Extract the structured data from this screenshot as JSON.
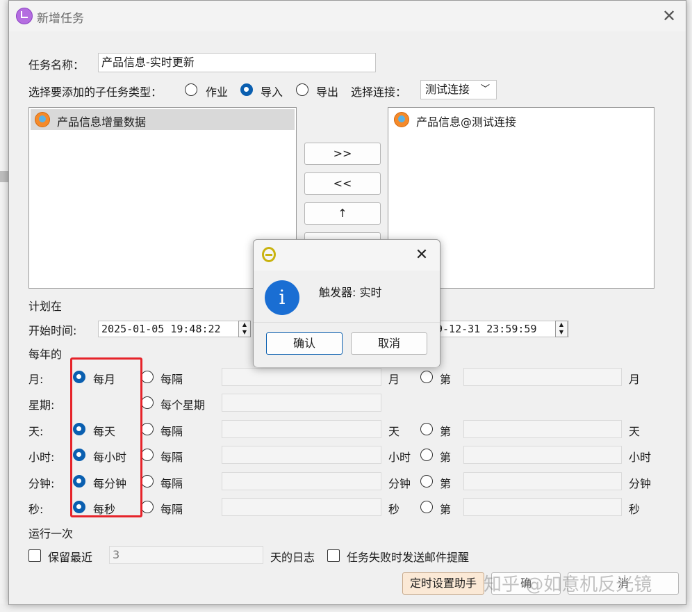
{
  "dialog": {
    "title": "新增任务",
    "close_symbol": "✕"
  },
  "task_name": {
    "label": "任务名称：",
    "value": "产品信息-实时更新"
  },
  "subtask": {
    "label": "选择要添加的子任务类型：",
    "options": [
      "作业",
      "导入",
      "导出"
    ],
    "selected": "导入",
    "connection_label": "选择连接：",
    "connection_value": "测试连接"
  },
  "left_list": {
    "items": [
      "产品信息增量数据"
    ]
  },
  "right_list": {
    "items": [
      "产品信息@测试连接"
    ]
  },
  "transfer_buttons": [
    ">>",
    "<<",
    "↑"
  ],
  "schedule": {
    "plan_label": "计划在",
    "start_label": "开始时间:",
    "start_value": "2025-01-05 19:48:22",
    "end_value_visible": "9-12-31 23:59:59",
    "yearly_label": "每年的",
    "rows": [
      {
        "label": "月:",
        "every": "每月",
        "interval": "每隔",
        "unit": "月",
        "nth": "第",
        "nth_unit": "月"
      },
      {
        "label": "星期:",
        "every_week": "每个星期"
      },
      {
        "label": "天:",
        "every": "每天",
        "interval": "每隔",
        "unit": "天",
        "nth": "第",
        "nth_unit": "天"
      },
      {
        "label": "小时:",
        "every": "每小时",
        "interval": "每隔",
        "unit": "小时",
        "nth": "第",
        "nth_unit": "小时"
      },
      {
        "label": "分钟:",
        "every": "每分钟",
        "interval": "每隔",
        "unit": "分钟",
        "nth": "第",
        "nth_unit": "分钟"
      },
      {
        "label": "秒:",
        "every": "每秒",
        "interval": "每隔",
        "unit": "秒",
        "nth": "第",
        "nth_unit": "秒"
      }
    ],
    "run_once_label": "运行一次"
  },
  "bottom": {
    "keep_label": "保留最近",
    "keep_value": "3",
    "days_log_label": "天的日志",
    "email_label": "任务失败时发送邮件提醒",
    "helper_button": "定时设置助手",
    "confirm_partial": "确",
    "cancel_partial": "消"
  },
  "message_box": {
    "text": "触发器: 实时",
    "info_glyph": "i",
    "ok_label": "确认",
    "cancel_label": "取消",
    "close_symbol": "✕"
  },
  "watermark": "知乎 @如意机反光镜",
  "colors": {
    "accent": "#0a5fb0",
    "highlight_box": "#e6232a",
    "info_icon": "#1a6ed3"
  }
}
